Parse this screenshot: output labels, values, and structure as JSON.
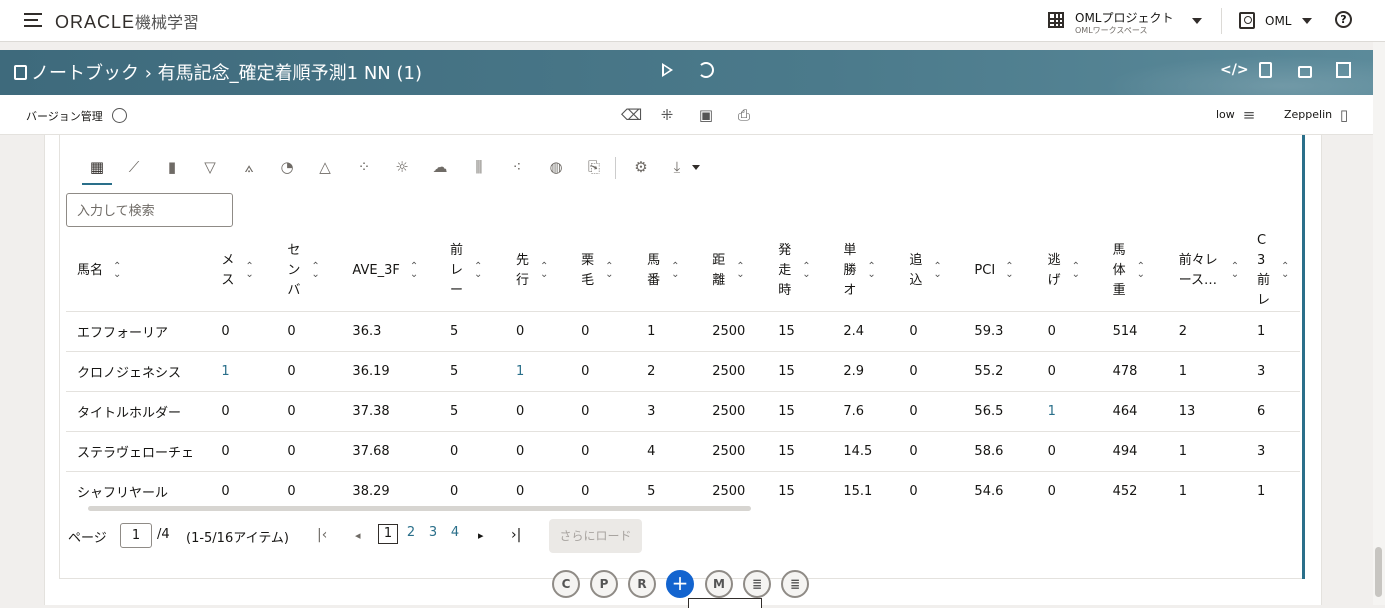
{
  "app": {
    "logo_main": "ORACLE",
    "logo_sub": "機械学習"
  },
  "project": {
    "name": "OMLプロジェクト",
    "workspace": "OMLワークスペース"
  },
  "user": {
    "name": "OML"
  },
  "help": "?",
  "breadcrumb": {
    "root": "ノートブック",
    "sep": "›",
    "notebook": "有馬記念_確定着順予測1 NN (1)"
  },
  "toolbar": {
    "version_label": "バージョン管理",
    "interpreter": "low",
    "mode": "Zeppelin"
  },
  "search": {
    "placeholder": "入力して検索"
  },
  "table": {
    "columns": [
      "馬名",
      "メス",
      "センバ",
      "AVE_3F",
      "前レー",
      "先行",
      "栗毛",
      "馬番",
      "距離",
      "発走時",
      "単勝オ",
      "追込",
      "PCI",
      "逃げ",
      "馬体重",
      "前々レース…",
      "C3前レ"
    ],
    "rows": [
      [
        "エフフォーリア",
        "0",
        "0",
        "36.3",
        "5",
        "0",
        "0",
        "1",
        "2500",
        "15",
        "2.4",
        "0",
        "59.3",
        "0",
        "514",
        "2",
        "1"
      ],
      [
        "クロノジェネシス",
        "1",
        "0",
        "36.19",
        "5",
        "1",
        "0",
        "2",
        "2500",
        "15",
        "2.9",
        "0",
        "55.2",
        "0",
        "478",
        "1",
        "3"
      ],
      [
        "タイトルホルダー",
        "0",
        "0",
        "37.38",
        "5",
        "0",
        "0",
        "3",
        "2500",
        "15",
        "7.6",
        "0",
        "56.5",
        "1",
        "464",
        "13",
        "6"
      ],
      [
        "ステラヴェローチェ",
        "0",
        "0",
        "37.68",
        "0",
        "0",
        "0",
        "4",
        "2500",
        "15",
        "14.5",
        "0",
        "58.6",
        "0",
        "494",
        "1",
        "3"
      ],
      [
        "シャフリヤール",
        "0",
        "0",
        "38.29",
        "0",
        "0",
        "0",
        "5",
        "2500",
        "15",
        "15.1",
        "0",
        "54.6",
        "0",
        "452",
        "1",
        "1"
      ]
    ]
  },
  "pager": {
    "page_label": "ページ",
    "current": "1",
    "total": "/4",
    "range": "(1-5/16アイテム)",
    "pages": [
      "1",
      "2",
      "3",
      "4"
    ],
    "load_more": "さらにロード"
  },
  "colors": {
    "accent": "#2a6f8a",
    "banner": "#4b7a8b",
    "add": "#1364cf"
  }
}
